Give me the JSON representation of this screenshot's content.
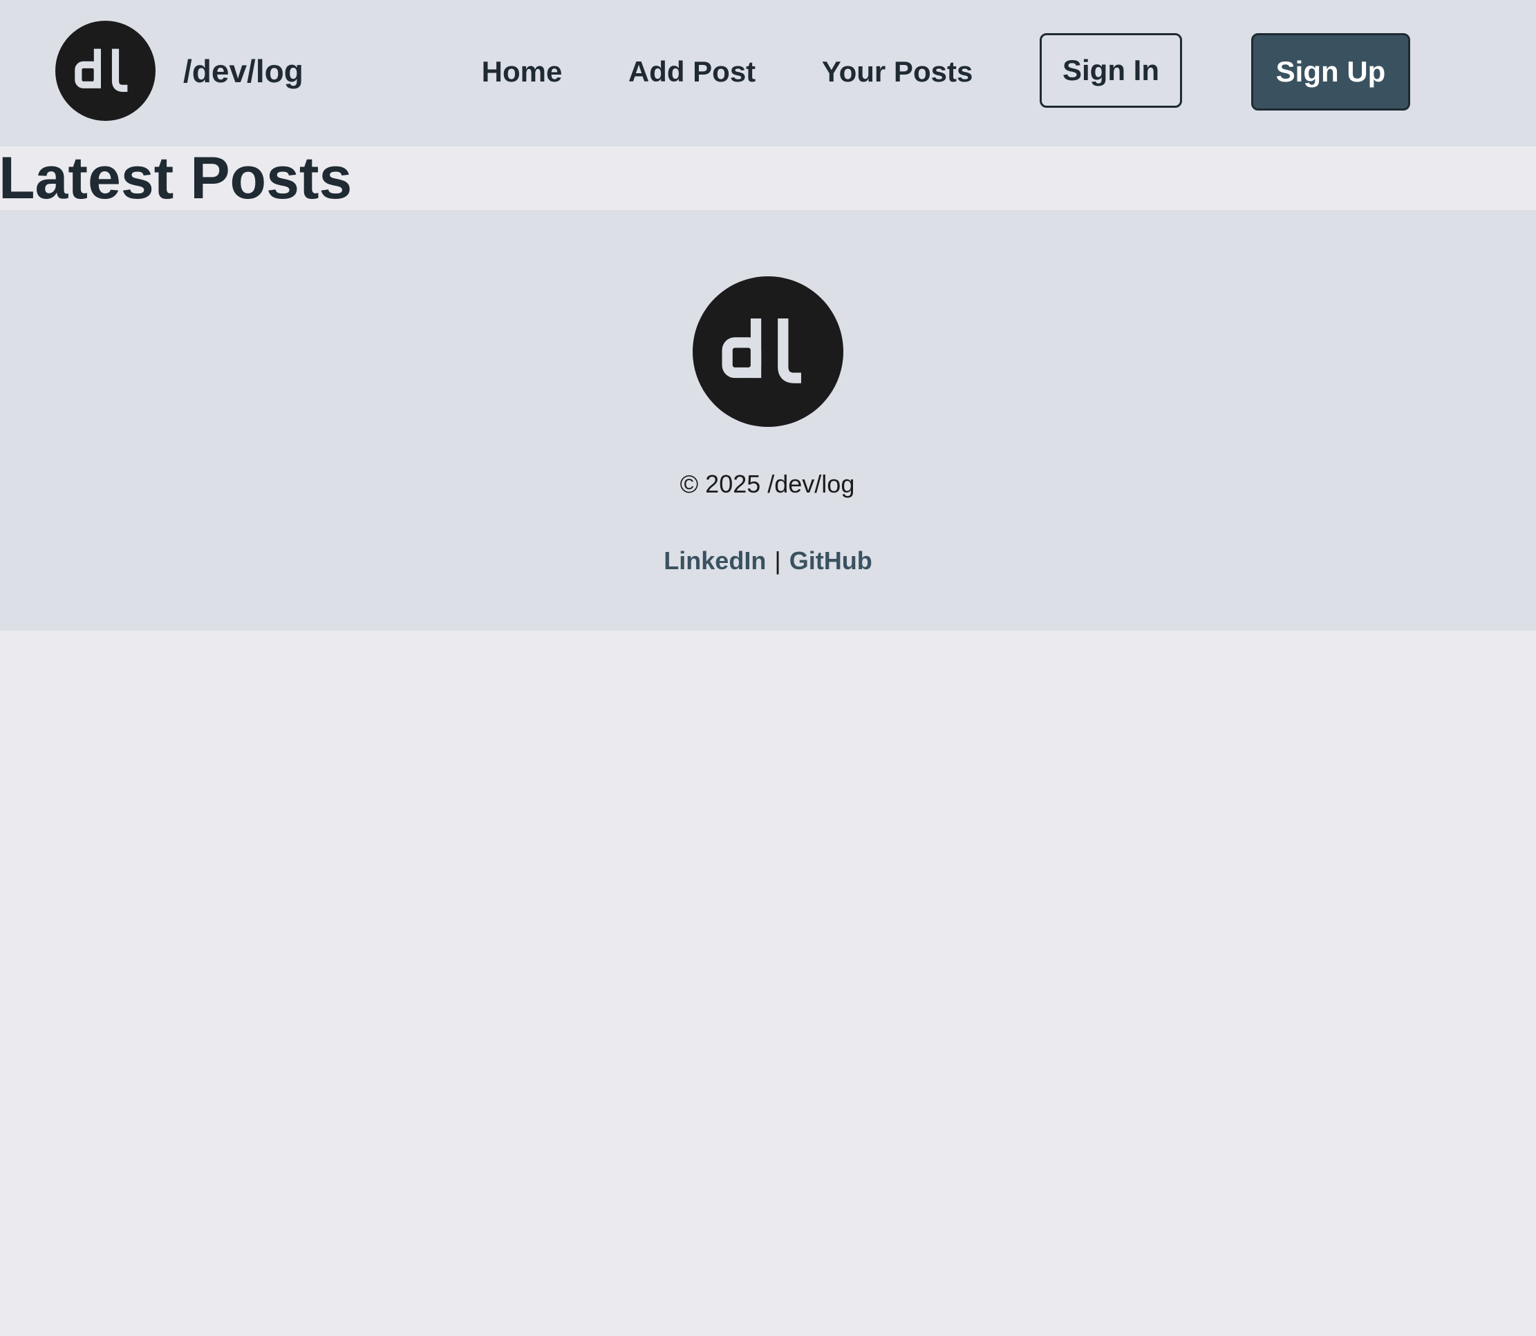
{
  "header": {
    "site_name": "/dev/log",
    "nav": {
      "home": "Home",
      "add_post": "Add Post",
      "your_posts": "Your Posts"
    },
    "sign_in": "Sign In",
    "sign_up": "Sign Up"
  },
  "main": {
    "title": "Latest Posts"
  },
  "footer": {
    "copyright": "© 2025 /dev/log",
    "links": {
      "linkedin": "LinkedIn",
      "separator": "|",
      "github": "GitHub"
    }
  },
  "colors": {
    "header_bg": "#dcdfe6",
    "page_bg": "#ebebef",
    "text": "#1f2a33",
    "accent": "#3a5260",
    "logo_bg": "#1b1b1b",
    "logo_fg": "#dcdfe6"
  }
}
